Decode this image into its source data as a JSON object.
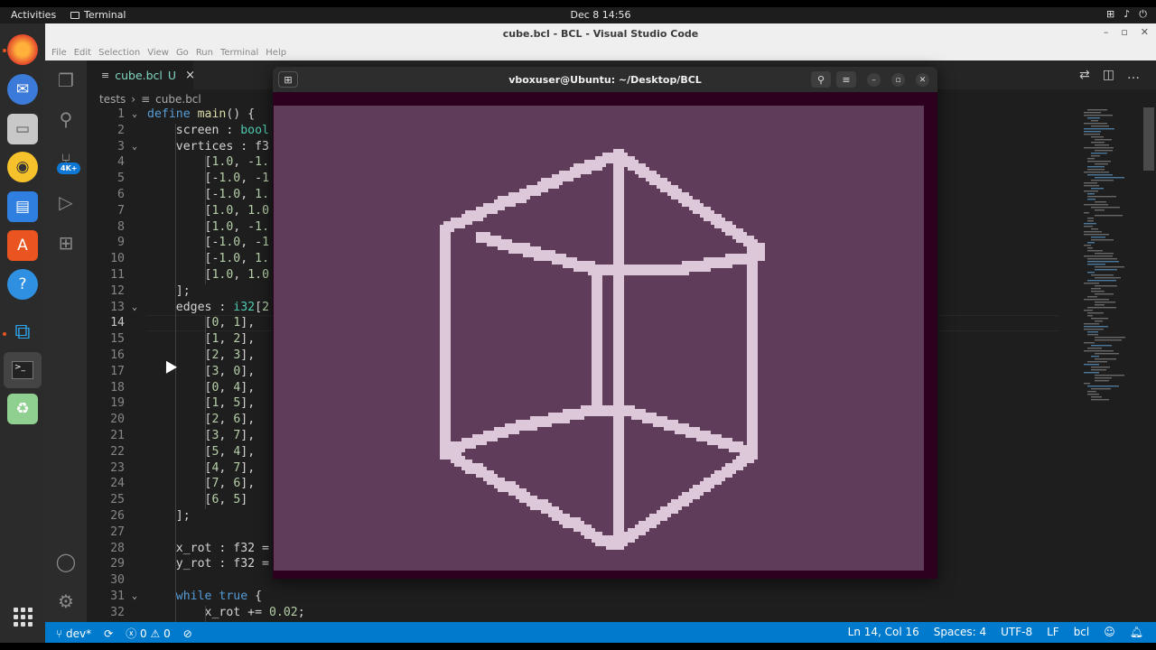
{
  "topbar": {
    "activities": "Activities",
    "app_name": "Terminal",
    "clock": "Dec 8  14:56"
  },
  "window": {
    "title": "cube.bcl - BCL - Visual Studio Code",
    "menu": [
      "File",
      "Edit",
      "Selection",
      "View",
      "Go",
      "Run",
      "Terminal",
      "Help"
    ]
  },
  "activity": {
    "badge": "4K+"
  },
  "tab": {
    "label": "cube.bcl",
    "status": "U",
    "close": "×"
  },
  "breadcrumb": {
    "folder": "tests",
    "file": "cube.bcl"
  },
  "code_lines": [
    {
      "n": "1",
      "fold": "⌄",
      "html": "<span class='kw'>define</span> <span class='fn'>main</span>() {"
    },
    {
      "n": "2",
      "fold": "",
      "html": "    screen : <span class='ty'>bool</span>"
    },
    {
      "n": "3",
      "fold": "⌄",
      "html": "    vertices : f3"
    },
    {
      "n": "4",
      "fold": "",
      "html": "        [<span class='num'>1.0</span>, -<span class='num'>1.</span>"
    },
    {
      "n": "5",
      "fold": "",
      "html": "        [-<span class='num'>1.0</span>, -<span class='num'>1</span>"
    },
    {
      "n": "6",
      "fold": "",
      "html": "        [-<span class='num'>1.0</span>, <span class='num'>1.</span>"
    },
    {
      "n": "7",
      "fold": "",
      "html": "        [<span class='num'>1.0</span>, <span class='num'>1.0</span>"
    },
    {
      "n": "8",
      "fold": "",
      "html": "        [<span class='num'>1.0</span>, -<span class='num'>1.</span>"
    },
    {
      "n": "9",
      "fold": "",
      "html": "        [-<span class='num'>1.0</span>, -<span class='num'>1</span>"
    },
    {
      "n": "10",
      "fold": "",
      "html": "        [-<span class='num'>1.0</span>, <span class='num'>1.</span>"
    },
    {
      "n": "11",
      "fold": "",
      "html": "        [<span class='num'>1.0</span>, <span class='num'>1.0</span>"
    },
    {
      "n": "12",
      "fold": "",
      "html": "    ];"
    },
    {
      "n": "13",
      "fold": "⌄",
      "html": "    edges : <span class='ty'>i32</span>[<span class='num'>2</span>"
    },
    {
      "n": "14",
      "fold": "",
      "html": "        [<span class='num'>0</span>, <span class='num'>1</span>],"
    },
    {
      "n": "15",
      "fold": "",
      "html": "        [<span class='num'>1</span>, <span class='num'>2</span>],"
    },
    {
      "n": "16",
      "fold": "",
      "html": "        [<span class='num'>2</span>, <span class='num'>3</span>],"
    },
    {
      "n": "17",
      "fold": "",
      "html": "        [<span class='num'>3</span>, <span class='num'>0</span>],"
    },
    {
      "n": "18",
      "fold": "",
      "html": "        [<span class='num'>0</span>, <span class='num'>4</span>],"
    },
    {
      "n": "19",
      "fold": "",
      "html": "        [<span class='num'>1</span>, <span class='num'>5</span>],"
    },
    {
      "n": "20",
      "fold": "",
      "html": "        [<span class='num'>2</span>, <span class='num'>6</span>],"
    },
    {
      "n": "21",
      "fold": "",
      "html": "        [<span class='num'>3</span>, <span class='num'>7</span>],"
    },
    {
      "n": "22",
      "fold": "",
      "html": "        [<span class='num'>5</span>, <span class='num'>4</span>],"
    },
    {
      "n": "23",
      "fold": "",
      "html": "        [<span class='num'>4</span>, <span class='num'>7</span>],"
    },
    {
      "n": "24",
      "fold": "",
      "html": "        [<span class='num'>7</span>, <span class='num'>6</span>],"
    },
    {
      "n": "25",
      "fold": "",
      "html": "        [<span class='num'>6</span>, <span class='num'>5</span>]"
    },
    {
      "n": "26",
      "fold": "",
      "html": "    ];"
    },
    {
      "n": "27",
      "fold": "",
      "html": ""
    },
    {
      "n": "28",
      "fold": "",
      "html": "    x_rot : f32 ="
    },
    {
      "n": "29",
      "fold": "",
      "html": "    y_rot : f32 ="
    },
    {
      "n": "30",
      "fold": "",
      "html": ""
    },
    {
      "n": "31",
      "fold": "⌄",
      "html": "    <span class='kw'>while</span> <span class='kw'>true</span> {"
    },
    {
      "n": "32",
      "fold": "",
      "html": "        x_rot += <span class='num'>0.02</span>;"
    }
  ],
  "current_line": "14",
  "statusbar": {
    "branch": "dev*",
    "errors": "0",
    "warnings": "0",
    "position": "Ln 14, Col 16",
    "spaces": "Spaces: 4",
    "encoding": "UTF-8",
    "eol": "LF",
    "language": "bcl"
  },
  "terminal": {
    "title": "vboxuser@Ubuntu: ~/Desktop/BCL"
  },
  "colors": {
    "accent": "#007acc",
    "terminal_bg": "#2c001e",
    "canvas_bg": "#5e3c5a",
    "cube_pixels": "#dcc8d9"
  }
}
